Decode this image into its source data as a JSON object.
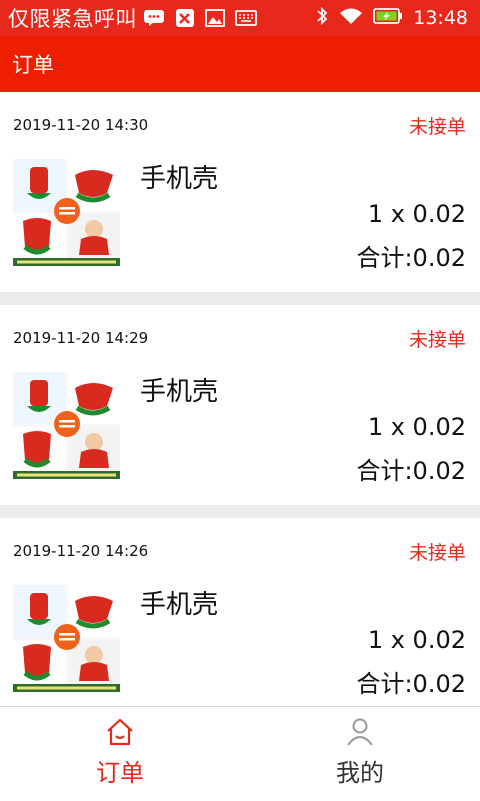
{
  "status_bar": {
    "notice": "仅限紧急呼叫",
    "time": "13:48",
    "icons": [
      "message-icon",
      "tool-icon",
      "image-icon",
      "keyboard-icon",
      "bluetooth-icon",
      "wifi-icon",
      "battery-charging-icon"
    ]
  },
  "app_bar": {
    "title": "订单"
  },
  "orders": [
    {
      "date": "2019-11-20 14:30",
      "status": "未接单",
      "title": "手机壳",
      "quantity": "1 x 0.02",
      "total": "合计:0.02"
    },
    {
      "date": "2019-11-20 14:29",
      "status": "未接单",
      "title": "手机壳",
      "quantity": "1 x 0.02",
      "total": "合计:0.02"
    },
    {
      "date": "2019-11-20 14:26",
      "status": "未接单",
      "title": "手机壳",
      "quantity": "1 x 0.02",
      "total": "合计:0.02"
    }
  ],
  "bottom_nav": {
    "items": [
      {
        "label": "订单",
        "icon": "home-icon",
        "active": true
      },
      {
        "label": "我的",
        "icon": "user-icon",
        "active": false
      }
    ]
  },
  "colors": {
    "accent": "#e8281b",
    "app_bar": "#f01e00",
    "background": "#ebebeb"
  }
}
